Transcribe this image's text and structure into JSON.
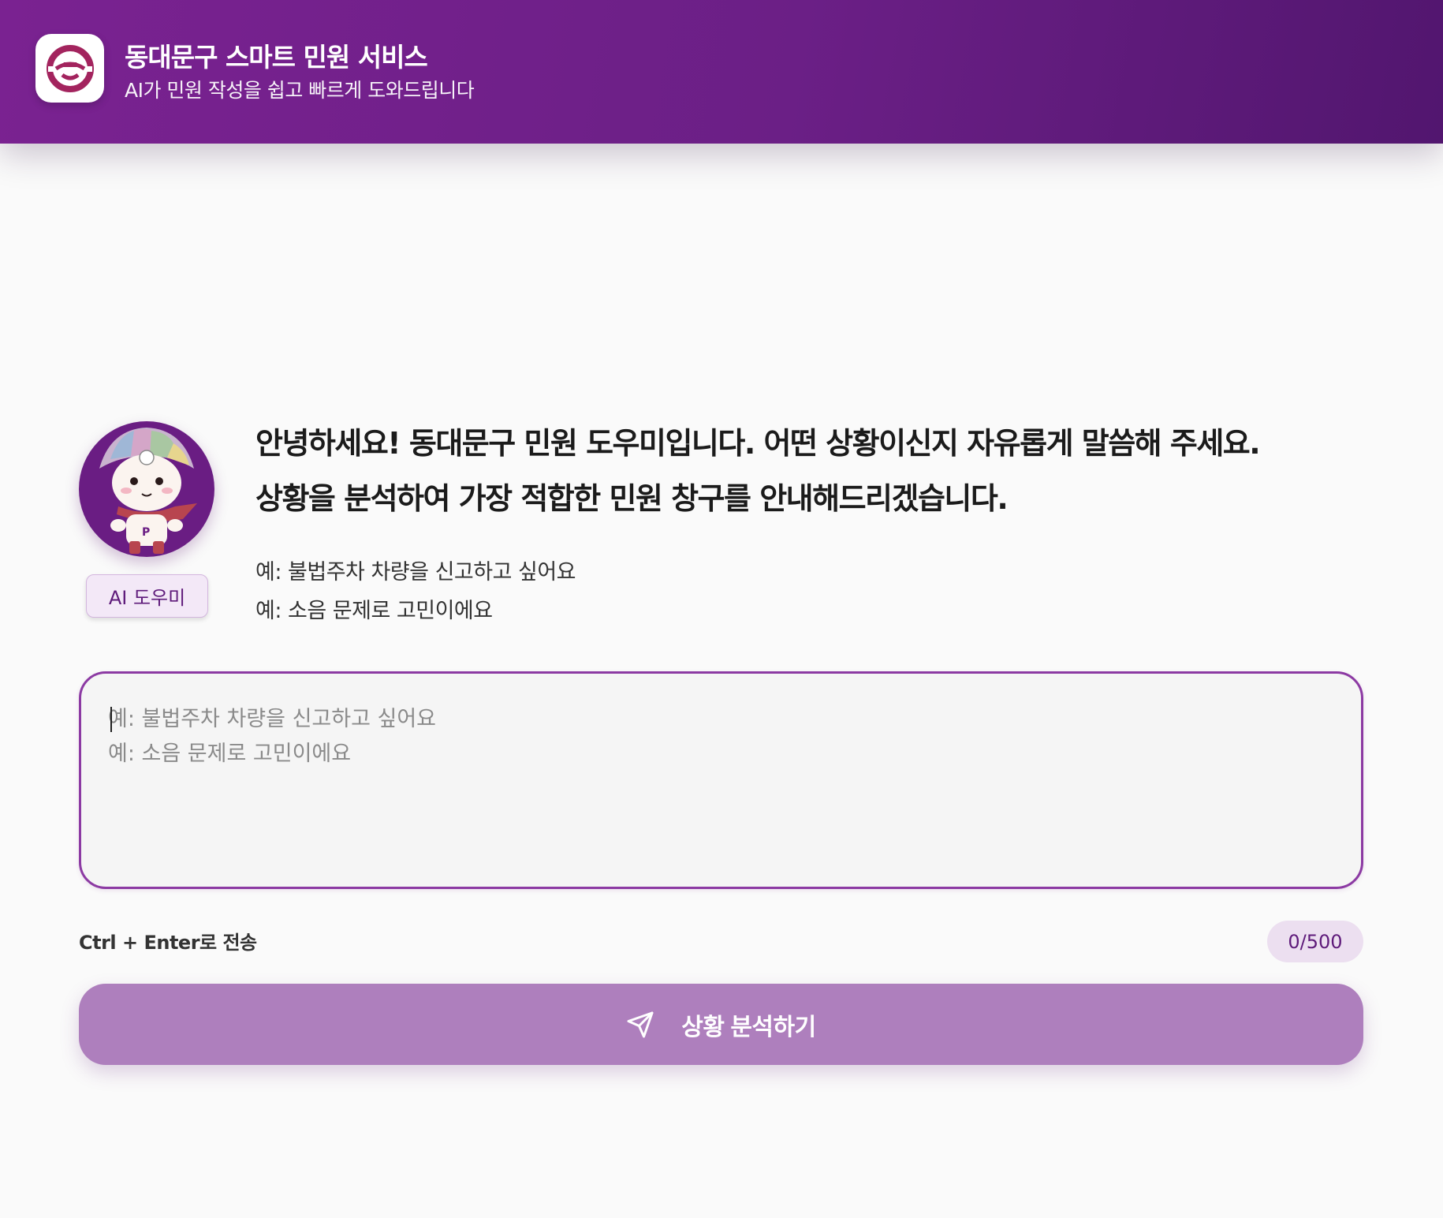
{
  "header": {
    "title": "동대문구 스마트 민원 서비스",
    "subtitle": "AI가 민원 작성을 쉽고 빠르게 도와드립니다",
    "logo_icon": "dongdaemun-logo-icon"
  },
  "assistant": {
    "avatar": "mascot-avatar",
    "badge_label": "AI 도우미",
    "greeting_lines": [
      "안녕하세요! 동대문구 민원 도우미입니다. 어떤 상황이신지 자유롭게 말씀해 주세요.",
      "상황을 분석하여 가장 적합한 민원 창구를 안내해드리겠습니다."
    ],
    "examples": [
      "예: 불법주차 차량을 신고하고 싶어요",
      "예: 소음 문제로 고민이에요"
    ]
  },
  "composer": {
    "value": "",
    "placeholder": "예: 불법주차 차량을 신고하고 싶어요\n예: 소음 문제로 고민이에요",
    "shortcut_hint": "Ctrl + Enter로 전송",
    "char_count": "0/500",
    "submit_label": "상황 분석하기",
    "submit_icon": "send-icon"
  },
  "colors": {
    "header_bg": "#6b1f86",
    "accent": "#8c3aa3",
    "button_bg": "#ae7fbd",
    "badge_bg": "#f3e8f7"
  }
}
